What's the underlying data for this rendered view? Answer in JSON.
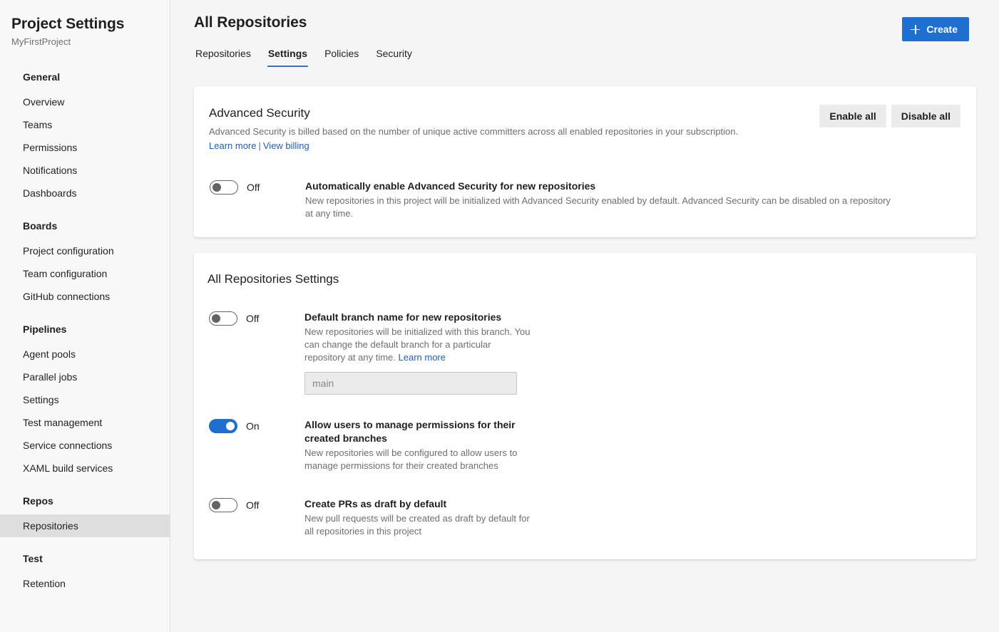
{
  "sidebar": {
    "title": "Project Settings",
    "project_name": "MyFirstProject",
    "groups": [
      {
        "header": "General",
        "items": [
          {
            "label": "Overview",
            "selected": false
          },
          {
            "label": "Teams",
            "selected": false
          },
          {
            "label": "Permissions",
            "selected": false
          },
          {
            "label": "Notifications",
            "selected": false
          },
          {
            "label": "Dashboards",
            "selected": false
          }
        ]
      },
      {
        "header": "Boards",
        "items": [
          {
            "label": "Project configuration",
            "selected": false
          },
          {
            "label": "Team configuration",
            "selected": false
          },
          {
            "label": "GitHub connections",
            "selected": false
          }
        ]
      },
      {
        "header": "Pipelines",
        "items": [
          {
            "label": "Agent pools",
            "selected": false
          },
          {
            "label": "Parallel jobs",
            "selected": false
          },
          {
            "label": "Settings",
            "selected": false
          },
          {
            "label": "Test management",
            "selected": false
          },
          {
            "label": "Service connections",
            "selected": false
          },
          {
            "label": "XAML build services",
            "selected": false
          }
        ]
      },
      {
        "header": "Repos",
        "items": [
          {
            "label": "Repositories",
            "selected": true
          }
        ]
      },
      {
        "header": "Test",
        "items": [
          {
            "label": "Retention",
            "selected": false
          }
        ]
      }
    ]
  },
  "header": {
    "page_title": "All Repositories",
    "create_button": "Create",
    "create_icon": "plus-icon",
    "tabs": [
      {
        "label": "Repositories",
        "active": false
      },
      {
        "label": "Settings",
        "active": true
      },
      {
        "label": "Policies",
        "active": false
      },
      {
        "label": "Security",
        "active": false
      }
    ]
  },
  "advanced_security": {
    "title": "Advanced Security",
    "subtitle": "Advanced Security is billed based on the number of unique active committers across all enabled repositories in your subscription.",
    "learn_more_link": "Learn more",
    "link_separator": "|",
    "view_billing_link": "View billing",
    "enable_all_button": "Enable all",
    "disable_all_button": "Disable all",
    "setting": {
      "toggle_state": "Off",
      "toggle_on": false,
      "title": "Automatically enable Advanced Security for new repositories",
      "description": "New repositories in this project will be initialized with Advanced Security enabled by default. Advanced Security can be disabled on a repository at any time."
    }
  },
  "all_repositories_settings": {
    "title": "All Repositories Settings",
    "settings": [
      {
        "toggle_state": "Off",
        "toggle_on": false,
        "title": "Default branch name for new repositories",
        "description": "New repositories will be initialized with this branch. You can change the default branch for a particular repository at any time. ",
        "inline_link": "Learn more",
        "input_placeholder": "main",
        "input_value": ""
      },
      {
        "toggle_state": "On",
        "toggle_on": true,
        "title": "Allow users to manage permissions for their created branches",
        "description": "New repositories will be configured to allow users to manage permissions for their created branches"
      },
      {
        "toggle_state": "Off",
        "toggle_on": false,
        "title": "Create PRs as draft by default",
        "description": "New pull requests will be created as draft by default for all repositories in this project"
      }
    ]
  },
  "colors": {
    "accent_blue": "#1f6fd0",
    "link_blue": "#1f5fad",
    "tab_underline": "#3b6fbf",
    "page_background": "#f5f5f5",
    "sidebar_background": "#f8f8f8",
    "card_background": "#ffffff",
    "selected_nav": "#dedede",
    "muted_text": "#6e6e6e"
  }
}
